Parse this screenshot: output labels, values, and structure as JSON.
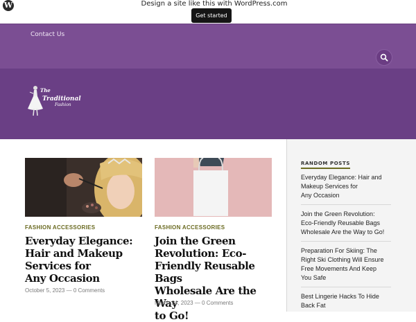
{
  "promo": {
    "text": "Design a site like this with WordPress.com",
    "button_label": "Get started"
  },
  "nav": {
    "contact_label": "Contact Us",
    "search_icon": "search-icon"
  },
  "site": {
    "logo_text_line1": "The",
    "logo_text_line2": "Traditional",
    "logo_text_line3": "Fashion"
  },
  "posts": [
    {
      "category": "FASHION ACCESSORIES",
      "title_lines": [
        "Everyday Elegance:",
        "Hair and Makeup",
        "Services for",
        "Any Occasion"
      ],
      "date": "October 5, 2023",
      "comments": "0 Comments"
    },
    {
      "category": "FASHION ACCESSORIES",
      "title_lines": [
        "Join the Green",
        "Revolution: Eco-",
        "Friendly Reusable Bags",
        "Wholesale Are the Way",
        "to Go!"
      ],
      "date": "March 24, 2023",
      "comments": "0 Comments"
    }
  ],
  "sidebar": {
    "title": "RANDOM POSTS",
    "items": [
      {
        "lines": [
          "Everyday Elegance: Hair and",
          "Makeup Services for",
          "Any Occasion"
        ]
      },
      {
        "lines": [
          "Join the Green Revolution:",
          "Eco-Friendly Reusable Bags",
          "Wholesale Are the Way to Go!"
        ]
      },
      {
        "lines": [
          "Preparation For Skiing: The",
          "Right Ski Clothing Will Ensure",
          "Free Movements And Keep",
          "You Safe"
        ]
      },
      {
        "lines": [
          "Best Lingerie Hacks To Hide",
          "Back Fat"
        ]
      }
    ]
  },
  "colors": {
    "header_purple": "#7b4e93",
    "branding_purple": "#6a3f85",
    "category_olive": "#6b6b22"
  }
}
